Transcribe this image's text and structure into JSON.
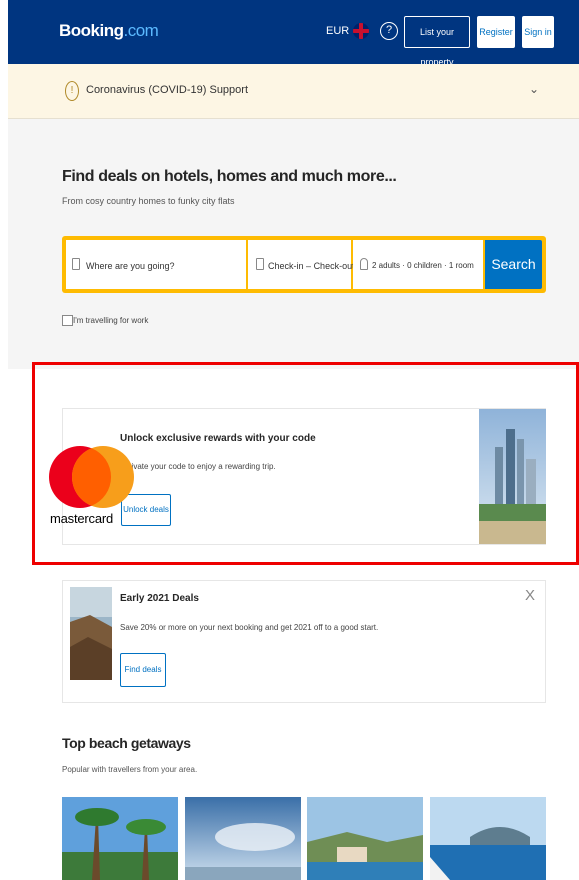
{
  "header": {
    "logo_main": "Booking",
    "logo_suffix": ".com",
    "currency": "EUR",
    "help_glyph": "?",
    "list_property": "List your property",
    "register": "Register",
    "sign_in": "Sign in"
  },
  "covid": {
    "text": "Coronavirus (COVID-19) Support",
    "icon_glyph": "!",
    "chevron": "⌄"
  },
  "hero": {
    "title": "Find deals on hotels, homes and much more...",
    "subtitle": "From cosy country homes to funky city flats"
  },
  "search": {
    "destination_placeholder": "Where are you going?",
    "check_in": "Check-in",
    "dash": "–",
    "check_out": "Check-out",
    "guests": "2 adults · 0 children · 1 room",
    "button": "Search",
    "work_label": "I'm travelling for work"
  },
  "promo": {
    "title": "Unlock exclusive rewards with your code",
    "subtitle": "Activate your code to enjoy a rewarding trip.",
    "button": "Unlock deals"
  },
  "overlay": {
    "brand_word": "mastercard",
    "colors": {
      "red": "#eb001b",
      "orange": "#f79e1b",
      "overlap": "#ff5f00"
    }
  },
  "deal": {
    "title": "Early 2021 Deals",
    "subtitle": "Save 20% or more on your next booking and get 2021 off to a good start.",
    "button": "Find deals",
    "close_glyph": "X"
  },
  "beach": {
    "title": "Top beach getaways",
    "subtitle": "Popular with travellers from your area."
  },
  "colors": {
    "brand_blue": "#003580",
    "accent_blue": "#0071c2",
    "search_yellow": "#febb02",
    "highlight_red": "#ee0000"
  }
}
